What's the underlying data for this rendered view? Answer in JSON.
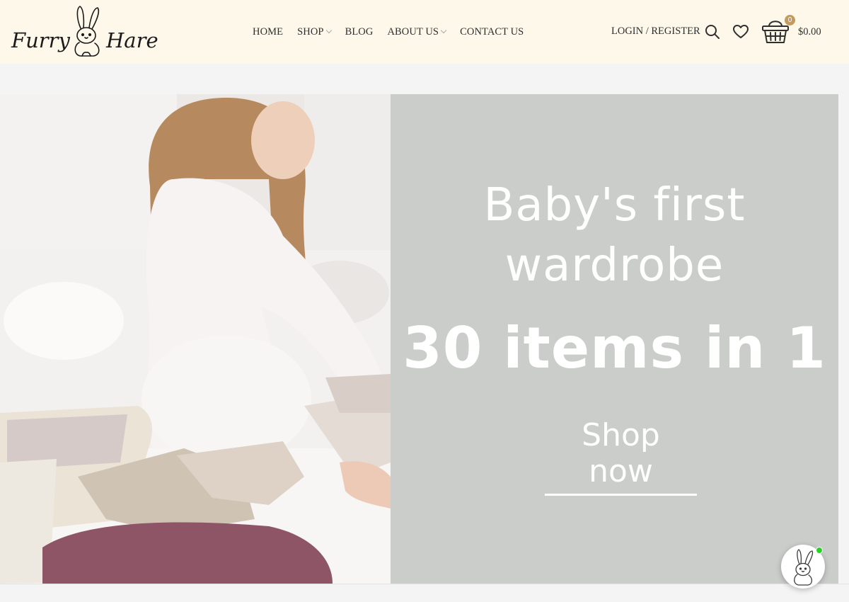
{
  "header": {
    "logo_left": "Furry",
    "logo_right": "Hare",
    "nav": [
      {
        "label": "HOME",
        "dropdown": false
      },
      {
        "label": "SHOP",
        "dropdown": true
      },
      {
        "label": "BLOG",
        "dropdown": false
      },
      {
        "label": "ABOUT US",
        "dropdown": true
      },
      {
        "label": "CONTACT US",
        "dropdown": false
      }
    ],
    "login_label": "LOGIN / REGISTER",
    "cart_count": "0",
    "cart_total": "$0.00",
    "icons": [
      "search-icon",
      "heart-icon",
      "basket-icon"
    ]
  },
  "hero": {
    "line1": "Baby's first",
    "line2": "wardrobe",
    "big": "30 items in 1",
    "cta": "Shop now",
    "panel_color": "#cbcdca"
  },
  "colors": {
    "header_bg": "#fdf8ea",
    "badge": "#c49a5e",
    "online": "#2bd12b"
  }
}
